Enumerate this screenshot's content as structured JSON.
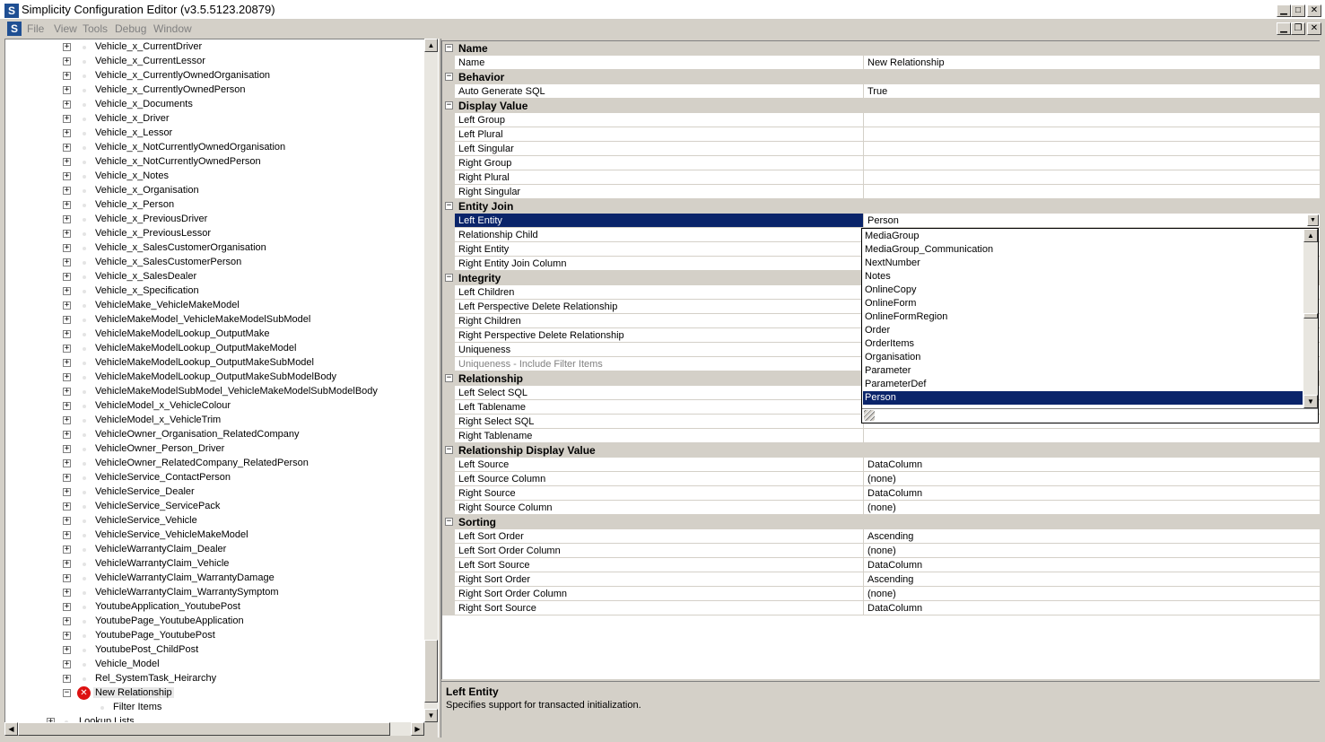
{
  "window": {
    "title": "Simplicity Configuration Editor (v3.5.5123.20879)",
    "app_icon_letter": "S"
  },
  "menu": {
    "items": [
      "File",
      "View",
      "Tools",
      "Debug",
      "Window"
    ]
  },
  "tree": {
    "items": [
      "Vehicle_x_CurrentDriver",
      "Vehicle_x_CurrentLessor",
      "Vehicle_x_CurrentlyOwnedOrganisation",
      "Vehicle_x_CurrentlyOwnedPerson",
      "Vehicle_x_Documents",
      "Vehicle_x_Driver",
      "Vehicle_x_Lessor",
      "Vehicle_x_NotCurrentlyOwnedOrganisation",
      "Vehicle_x_NotCurrentlyOwnedPerson",
      "Vehicle_x_Notes",
      "Vehicle_x_Organisation",
      "Vehicle_x_Person",
      "Vehicle_x_PreviousDriver",
      "Vehicle_x_PreviousLessor",
      "Vehicle_x_SalesCustomerOrganisation",
      "Vehicle_x_SalesCustomerPerson",
      "Vehicle_x_SalesDealer",
      "Vehicle_x_Specification",
      "VehicleMake_VehicleMakeModel",
      "VehicleMakeModel_VehicleMakeModelSubModel",
      "VehicleMakeModelLookup_OutputMake",
      "VehicleMakeModelLookup_OutputMakeModel",
      "VehicleMakeModelLookup_OutputMakeSubModel",
      "VehicleMakeModelLookup_OutputMakeSubModelBody",
      "VehicleMakeModelSubModel_VehicleMakeModelSubModelBody",
      "VehicleModel_x_VehicleColour",
      "VehicleModel_x_VehicleTrim",
      "VehicleOwner_Organisation_RelatedCompany",
      "VehicleOwner_Person_Driver",
      "VehicleOwner_RelatedCompany_RelatedPerson",
      "VehicleService_ContactPerson",
      "VehicleService_Dealer",
      "VehicleService_ServicePack",
      "VehicleService_Vehicle",
      "VehicleService_VehicleMakeModel",
      "VehicleWarrantyClaim_Dealer",
      "VehicleWarrantyClaim_Vehicle",
      "VehicleWarrantyClaim_WarrantyDamage",
      "VehicleWarrantyClaim_WarrantySymptom",
      "YoutubeApplication_YoutubePost",
      "YoutubePage_YoutubeApplication",
      "YoutubePage_YoutubePost",
      "YoutubePost_ChildPost",
      "Vehicle_Model",
      "Rel_SystemTask_Heirarchy"
    ],
    "selected_item": "New Relationship",
    "child_item": "Filter Items",
    "partial_item": "Lookup Lists"
  },
  "property_grid": {
    "rows": [
      {
        "type": "category",
        "label": "Name"
      },
      {
        "type": "prop",
        "name": "Name",
        "value": "New Relationship"
      },
      {
        "type": "category",
        "label": "Behavior"
      },
      {
        "type": "prop",
        "name": "Auto Generate SQL",
        "value": "True"
      },
      {
        "type": "category",
        "label": "Display Value"
      },
      {
        "type": "prop",
        "name": "Left Group",
        "value": ""
      },
      {
        "type": "prop",
        "name": "Left Plural",
        "value": ""
      },
      {
        "type": "prop",
        "name": "Left Singular",
        "value": ""
      },
      {
        "type": "prop",
        "name": "Right Group",
        "value": ""
      },
      {
        "type": "prop",
        "name": "Right Plural",
        "value": ""
      },
      {
        "type": "prop",
        "name": "Right Singular",
        "value": ""
      },
      {
        "type": "category",
        "label": "Entity Join"
      },
      {
        "type": "prop",
        "name": "Left Entity",
        "value": "Person",
        "selected": true
      },
      {
        "type": "prop",
        "name": "Relationship Child",
        "value": ""
      },
      {
        "type": "prop",
        "name": "Right Entity",
        "value": ""
      },
      {
        "type": "prop",
        "name": "Right Entity Join Column",
        "value": ""
      },
      {
        "type": "category",
        "label": "Integrity"
      },
      {
        "type": "prop",
        "name": "Left Children",
        "value": ""
      },
      {
        "type": "prop",
        "name": "Left Perspective Delete Relationship",
        "value": ""
      },
      {
        "type": "prop",
        "name": "Right Children",
        "value": ""
      },
      {
        "type": "prop",
        "name": "Right Perspective Delete Relationship",
        "value": ""
      },
      {
        "type": "prop",
        "name": "Uniqueness",
        "value": ""
      },
      {
        "type": "prop",
        "name": "Uniqueness - Include Filter Items",
        "value": "",
        "disabled": true
      },
      {
        "type": "category",
        "label": "Relationship"
      },
      {
        "type": "prop",
        "name": "Left Select SQL",
        "value": ""
      },
      {
        "type": "prop",
        "name": "Left Tablename",
        "value": ""
      },
      {
        "type": "prop",
        "name": "Right Select SQL",
        "value": ""
      },
      {
        "type": "prop",
        "name": "Right Tablename",
        "value": ""
      },
      {
        "type": "category",
        "label": "Relationship Display Value"
      },
      {
        "type": "prop",
        "name": "Left Source",
        "value": "DataColumn"
      },
      {
        "type": "prop",
        "name": "Left Source Column",
        "value": "(none)"
      },
      {
        "type": "prop",
        "name": "Right Source",
        "value": "DataColumn"
      },
      {
        "type": "prop",
        "name": "Right Source Column",
        "value": "(none)"
      },
      {
        "type": "category",
        "label": "Sorting"
      },
      {
        "type": "prop",
        "name": "Left Sort Order",
        "value": "Ascending"
      },
      {
        "type": "prop",
        "name": "Left Sort Order Column",
        "value": "(none)"
      },
      {
        "type": "prop",
        "name": "Left Sort Source",
        "value": "DataColumn"
      },
      {
        "type": "prop",
        "name": "Right Sort Order",
        "value": "Ascending"
      },
      {
        "type": "prop",
        "name": "Right Sort Order Column",
        "value": "(none)"
      },
      {
        "type": "prop",
        "name": "Right Sort Source",
        "value": "DataColumn"
      }
    ]
  },
  "dropdown": {
    "items": [
      "MediaGroup",
      "MediaGroup_Communication",
      "NextNumber",
      "Notes",
      "OnlineCopy",
      "OnlineForm",
      "OnlineFormRegion",
      "Order",
      "OrderItems",
      "Organisation",
      "Parameter",
      "ParameterDef",
      "Person"
    ],
    "selected": "Person"
  },
  "description": {
    "title": "Left Entity",
    "text": "Specifies support for transacted initialization."
  },
  "colors": {
    "selection": "#0a246a",
    "chrome": "#d4d0c8",
    "error": "#dd1111"
  }
}
